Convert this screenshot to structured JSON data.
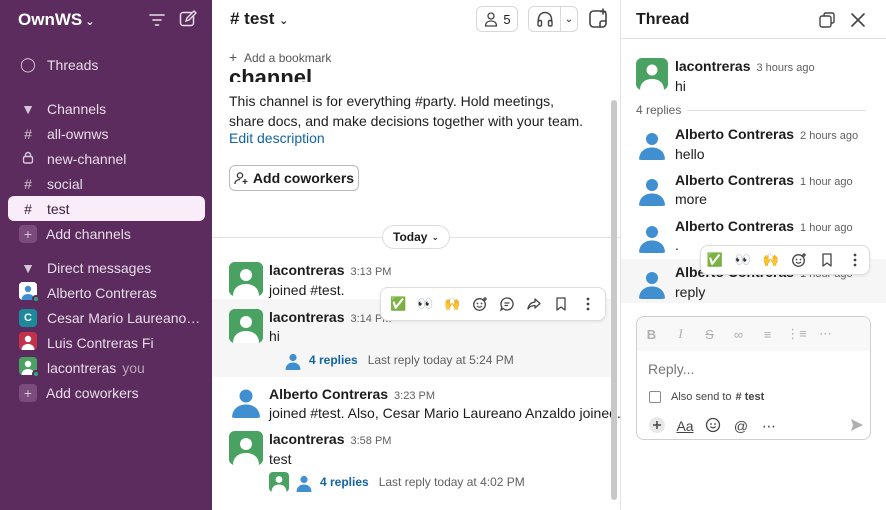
{
  "workspace": {
    "name": "OwnWS"
  },
  "sidebar": {
    "threads_label": "Threads",
    "channels_heading": "Channels",
    "channels": [
      {
        "label": "all-ownws",
        "icon": "#"
      },
      {
        "label": "new-channel",
        "icon": "lock"
      },
      {
        "label": "social",
        "icon": "#"
      },
      {
        "label": "test",
        "icon": "#",
        "active": true
      }
    ],
    "add_channels": "Add channels",
    "dm_heading": "Direct messages",
    "dms": [
      {
        "label": "Alberto Contreras"
      },
      {
        "label": "Cesar Mario Laureano A...",
        "initial": "C"
      },
      {
        "label": "Luis Contreras Fi"
      },
      {
        "label": "lacontreras",
        "suffix": "you"
      }
    ],
    "add_coworkers": "Add coworkers"
  },
  "channel": {
    "title": "# test",
    "member_count": "5",
    "bookmark_label": "Add a bookmark",
    "intro_heading": "channel",
    "intro_desc": "This channel is for everything #party. Hold meetings, share docs, and make decisions together with your team.",
    "edit_desc": "Edit description",
    "add_coworkers": "Add coworkers",
    "date_divider": "Today",
    "messages": [
      {
        "author": "lacontreras",
        "time": "3:13 PM",
        "text": "joined #test."
      },
      {
        "author": "lacontreras",
        "time": "3:14 PM",
        "text": "hi",
        "replies": "4 replies",
        "last_reply": "Last reply today at 5:24 PM"
      },
      {
        "author": "Alberto Contreras",
        "time": "3:23 PM",
        "text": "joined #test. Also, Cesar Mario Laureano Anzaldo joined."
      },
      {
        "author": "lacontreras",
        "time": "3:58 PM",
        "text": "test",
        "replies": "4 replies",
        "last_reply": "Last reply today at 4:02 PM"
      }
    ],
    "action_emojis": [
      "✅",
      "👀",
      "🙌"
    ]
  },
  "thread": {
    "title": "Thread",
    "parent": {
      "author": "lacontreras",
      "time": "3 hours ago",
      "text": "hi"
    },
    "reply_count": "4 replies",
    "replies": [
      {
        "author": "Alberto Contreras",
        "time": "2 hours ago",
        "text": "hello"
      },
      {
        "author": "Alberto Contreras",
        "time": "1 hour ago",
        "text": "more"
      },
      {
        "author": "Alberto Contreras",
        "time": "1 hour ago",
        "text": "."
      },
      {
        "author": "Alberto Contreras",
        "time": "1 hour ago",
        "text": "reply"
      }
    ],
    "composer": {
      "placeholder": "Reply...",
      "also_send": "Also send to",
      "also_send_channel": "# test"
    }
  },
  "colors": {
    "sidebar_bg": "#5b2c5d",
    "active_item_bg": "#f9edfa",
    "link": "#1264a3",
    "presence": "#2bac76"
  }
}
